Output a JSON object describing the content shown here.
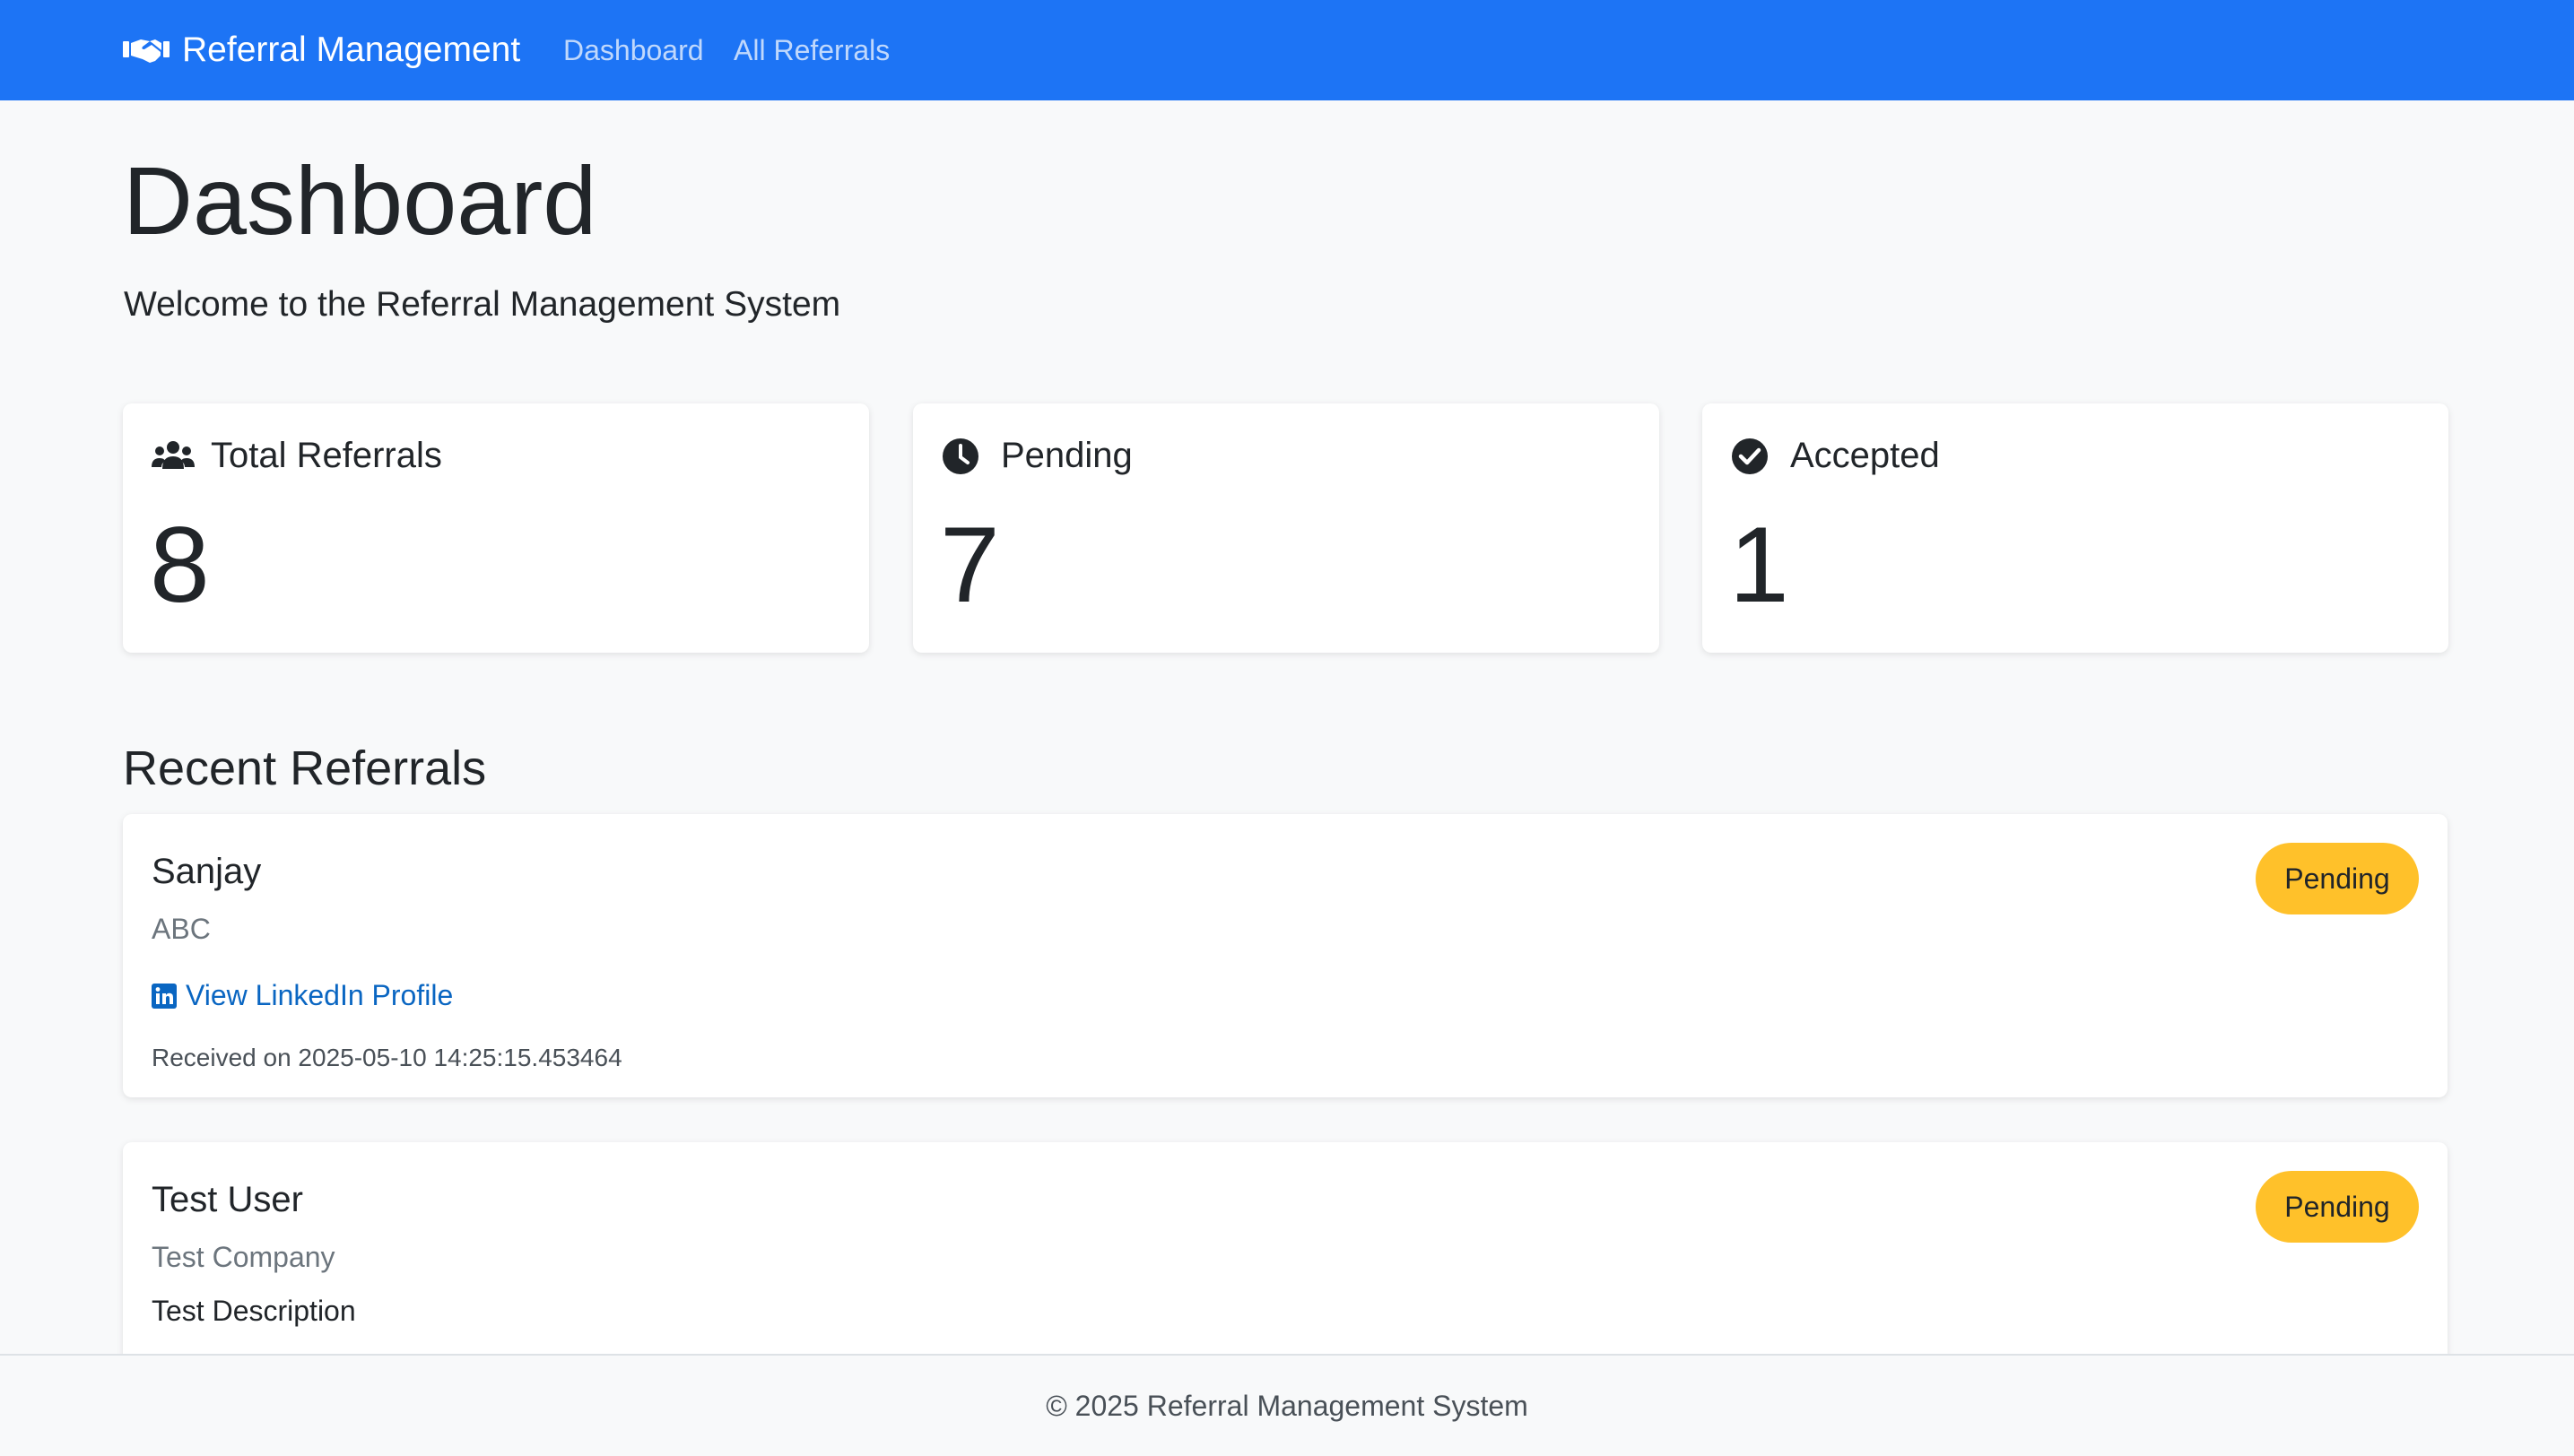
{
  "navbar": {
    "brand": "Referral Management",
    "brand_icon": "handshake-icon",
    "links": [
      "Dashboard",
      "All Referrals"
    ],
    "color": "#1d74f5"
  },
  "page": {
    "title": "Dashboard",
    "lead": "Welcome to the Referral Management System"
  },
  "stats": [
    {
      "label": "Total Referrals",
      "value": "8",
      "icon": "users-icon"
    },
    {
      "label": "Pending",
      "value": "7",
      "icon": "clock-icon"
    },
    {
      "label": "Accepted",
      "value": "1",
      "icon": "check-circle-icon"
    }
  ],
  "recent": {
    "title": "Recent Referrals",
    "items": [
      {
        "name": "Sanjay",
        "company": "ABC",
        "link_label": "View LinkedIn Profile",
        "link_icon": "linkedin-icon",
        "received": "Received on 2025-05-10 14:25:15.453464",
        "status": "Pending"
      },
      {
        "name": "Test User",
        "company": "Test Company",
        "description": "Test Description",
        "status": "Pending"
      }
    ]
  },
  "colors": {
    "pending_badge": "#ffc12a",
    "link": "#0a66c2"
  },
  "footer": {
    "text": "© 2025 Referral Management System"
  }
}
